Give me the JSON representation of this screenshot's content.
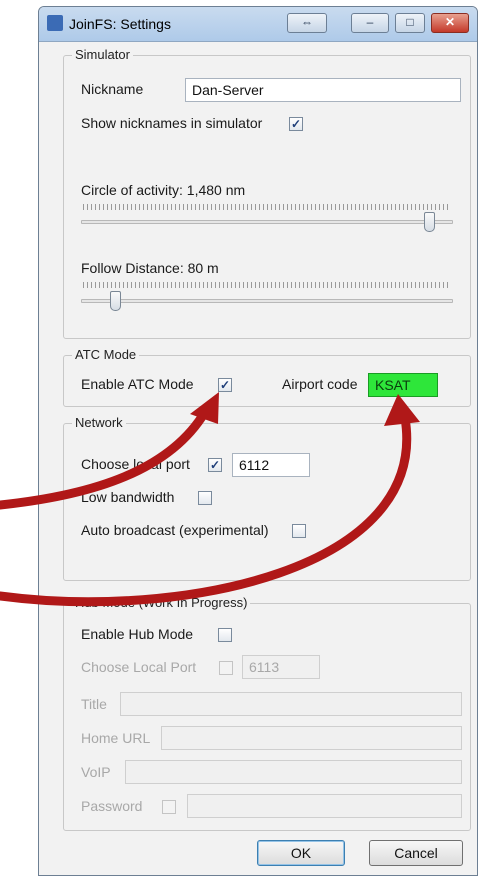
{
  "window": {
    "title": "JoinFS: Settings",
    "controls": {
      "swap": "⇔",
      "minimize": "–",
      "maximize": "□",
      "close": "✕"
    }
  },
  "simulator": {
    "title": "Simulator",
    "nickname_label": "Nickname",
    "nickname_value": "Dan-Server",
    "show_nicknames_label": "Show nicknames in simulator",
    "show_nicknames_checked": true,
    "circle_label": "Circle of activity: 1,480 nm",
    "circle_level": 0.95,
    "follow_label": "Follow Distance: 80 m",
    "follow_level": 0.08
  },
  "atc": {
    "title": "ATC Mode",
    "enable_label": "Enable ATC Mode",
    "enable_checked": true,
    "airport_label": "Airport code",
    "airport_value": "KSAT",
    "airport_color": "#2ee63a"
  },
  "network": {
    "title": "Network",
    "local_port_label": "Choose local port",
    "local_port_checked": true,
    "local_port_value": "6112",
    "low_bandwidth_label": "Low bandwidth",
    "low_bandwidth_checked": false,
    "auto_broadcast_label": "Auto broadcast (experimental)",
    "auto_broadcast_checked": false
  },
  "hub": {
    "title": "Hub Mode (Work In Progress)",
    "enable_label": "Enable Hub Mode",
    "enable_checked": false,
    "local_port_label": "Choose Local Port",
    "local_port_value": "6113",
    "title_label": "Title",
    "home_url_label": "Home URL",
    "voip_label": "VoIP",
    "password_label": "Password"
  },
  "buttons": {
    "ok": "OK",
    "cancel": "Cancel"
  },
  "annotation": {
    "arrow_color": "#b01818"
  }
}
